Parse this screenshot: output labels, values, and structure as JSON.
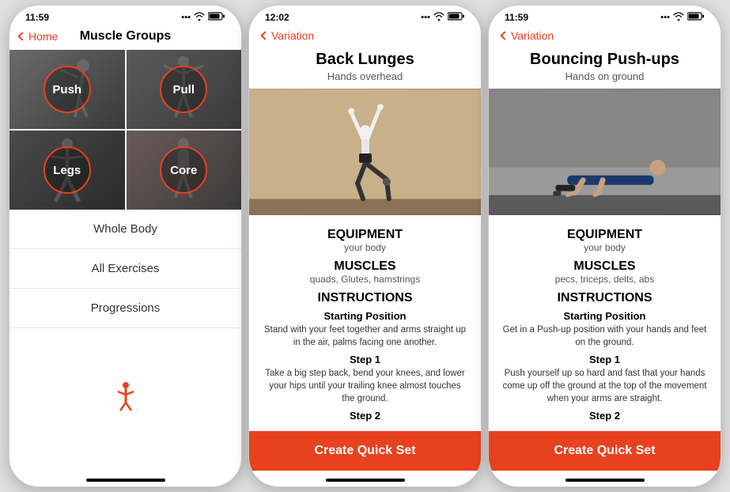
{
  "phone1": {
    "statusBar": {
      "time": "11:59"
    },
    "nav": {
      "back": "Home",
      "title": "Muscle Groups"
    },
    "grid": [
      {
        "label": "Push",
        "class": "cell-push"
      },
      {
        "label": "Pull",
        "class": "cell-pull"
      },
      {
        "label": "Legs",
        "class": "cell-legs"
      },
      {
        "label": "Core",
        "class": "cell-core"
      }
    ],
    "menuItems": [
      "Whole Body",
      "All Exercises",
      "Progressions"
    ]
  },
  "phone2": {
    "statusBar": {
      "time": "12:02"
    },
    "nav": {
      "back": "Variation"
    },
    "exercise": {
      "title": "Back Lunges",
      "subtitle": "Hands overhead",
      "sections": {
        "equipment": {
          "heading": "EQUIPMENT",
          "value": "your body"
        },
        "muscles": {
          "heading": "MUSCLES",
          "value": "quads, Glutes, hamstrings"
        },
        "instructions": {
          "heading": "INSTRUCTIONS",
          "steps": [
            {
              "title": "Starting Position",
              "text": "Stand with your feet together and arms straight up in the air, palms facing one another."
            },
            {
              "title": "Step 1",
              "text": "Take a big step back, bend your knees, and lower your hips until your trailing knee almost touches the ground."
            },
            {
              "title": "Step 2",
              "text": ""
            }
          ]
        }
      },
      "cta": "Create Quick Set"
    }
  },
  "phone3": {
    "statusBar": {
      "time": "11:59"
    },
    "nav": {
      "back": "Variation"
    },
    "exercise": {
      "title": "Bouncing Push-ups",
      "subtitle": "Hands on ground",
      "sections": {
        "equipment": {
          "heading": "EQUIPMENT",
          "value": "your body"
        },
        "muscles": {
          "heading": "MUSCLES",
          "value": "pecs, triceps, delts, abs"
        },
        "instructions": {
          "heading": "INSTRUCTIONS",
          "steps": [
            {
              "title": "Starting Position",
              "text": "Get in a Push-up position with your hands and feet on the ground."
            },
            {
              "title": "Step 1",
              "text": "Push yourself up so hard and fast that your hands come up off the ground at the top of the movement when your arms are straight."
            },
            {
              "title": "Step 2",
              "text": ""
            }
          ]
        }
      },
      "cta": "Create Quick Set"
    }
  }
}
